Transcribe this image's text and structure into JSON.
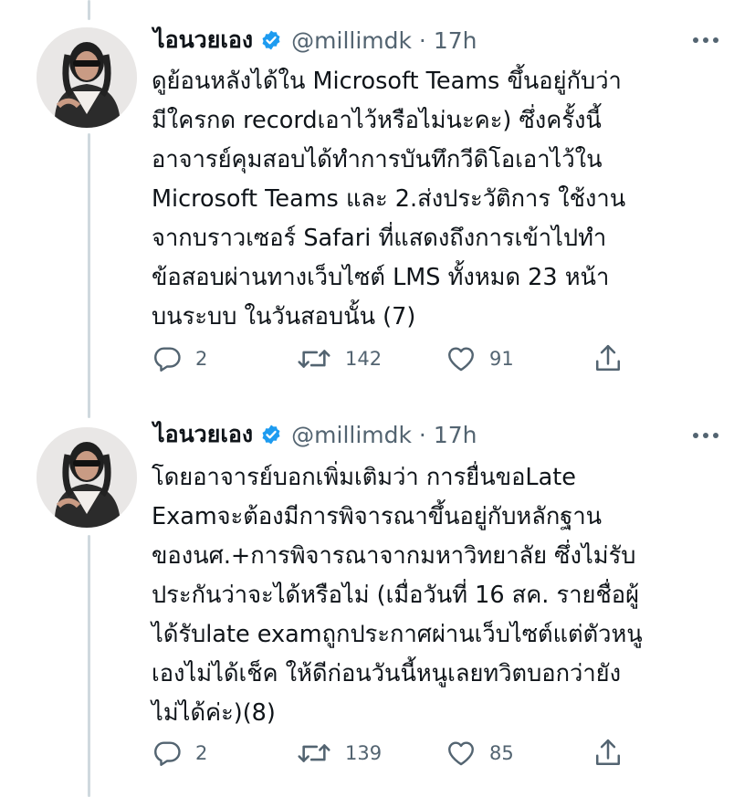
{
  "tweets": [
    {
      "display_name": "ไอนวยเอง",
      "handle_time": "@millimdk · 17h",
      "lines": [
        "ดูย้อนหลังได้ใน Microsoft Teams ขึ้นอยู่กับว่า",
        "มีใครกด recordเอาไว้หรือไม่นะคะ) ซึ่งครั้งนี้",
        "อาจารย์คุมสอบได้ทำการบันทึกวีดิโอเอาไว้ใน",
        "Microsoft Teams และ 2.ส่งประวัติการ ใช้งาน",
        "จากบราวเซอร์ Safari ที่แสดงถึงการเข้าไปทำ",
        "ข้อสอบผ่านทางเว็บไซต์ LMS ทั้งหมด 23 หน้า",
        "บนระบบ ในวันสอบนั้น (7)"
      ],
      "replies": "2",
      "retweets": "142",
      "likes": "91"
    },
    {
      "display_name": "ไอนวยเอง",
      "handle_time": "@millimdk · 17h",
      "lines": [
        "โดยอาจารย์บอกเพิ่มเติมว่า การยื่นขอLate",
        "Examจะต้องมีการพิจารณาขึ้นอยู่กับหลักฐาน",
        "ของนศ.+การพิจารณาจากมหาวิทยาลัย ซึ่งไม่รับ",
        "ประกันว่าจะได้หรือไม่  (เมื่อวันที่ 16 สค. รายชื่อผู้",
        "ได้รับlate examถูกประกาศผ่านเว็บไซต์แต่ตัวหนู",
        "เองไม่ได้เช็ค ให้ดีก่อนวันนี้หนูเลยทวิตบอกว่ายัง",
        "ไม่ได้ค่ะ)(8)"
      ],
      "replies": "2",
      "retweets": "139",
      "likes": "85"
    }
  ],
  "icons": {
    "verified": "verified-badge-icon",
    "more": "more-options-icon",
    "reply": "reply-icon",
    "retweet": "retweet-icon",
    "like": "like-icon",
    "share": "share-icon"
  },
  "colors": {
    "verified_blue": "#1d9bf0",
    "secondary_text": "#536471",
    "thread_line": "#cfd9de"
  }
}
